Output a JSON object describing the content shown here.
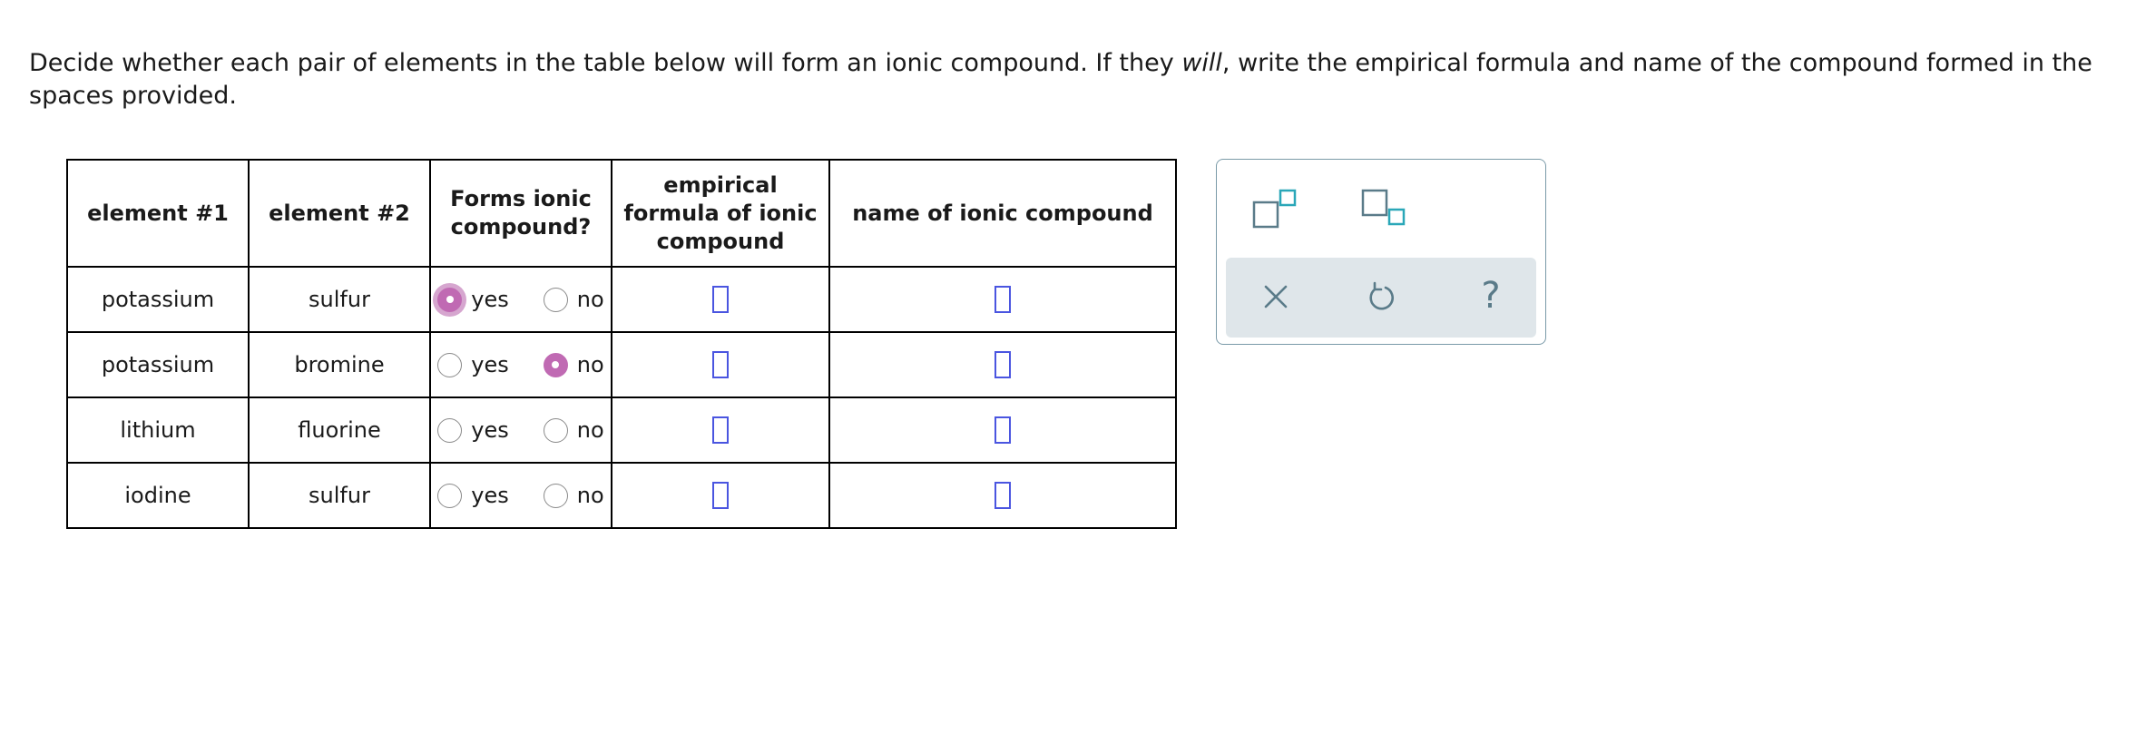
{
  "prompt": {
    "part1": "Decide whether each pair of elements in the table below will form an ionic compound. If they ",
    "emphasis": "will",
    "part2": ", write the empirical formula and name of the compound formed in the spaces provided."
  },
  "table": {
    "headers": {
      "element1": "element #1",
      "element2": "element #2",
      "forms_line1": "Forms ionic",
      "forms_line2": "compound?",
      "formula_line1": "empirical",
      "formula_line2": "formula of ionic",
      "formula_line3": "compound",
      "name": "name of ionic compound"
    },
    "yes_label": "yes",
    "no_label": "no",
    "rows": [
      {
        "element1": "potassium",
        "element2": "sulfur",
        "selected": "yes"
      },
      {
        "element1": "potassium",
        "element2": "bromine",
        "selected": "no"
      },
      {
        "element1": "lithium",
        "element2": "fluorine",
        "selected": ""
      },
      {
        "element1": "iodine",
        "element2": "sulfur",
        "selected": ""
      }
    ]
  },
  "toolbar": {
    "icons": [
      "superscript-icon",
      "subscript-icon",
      "clear-icon",
      "undo-icon",
      "help-icon"
    ],
    "help_glyph": "?"
  },
  "colors": {
    "radio_selected": "#c06ab3",
    "answer_slot": "#4a55e0",
    "toolbar_bg": "#dfe6ea",
    "tool_icon": "#5a7b89",
    "tool_accent": "#2aa7b8"
  }
}
